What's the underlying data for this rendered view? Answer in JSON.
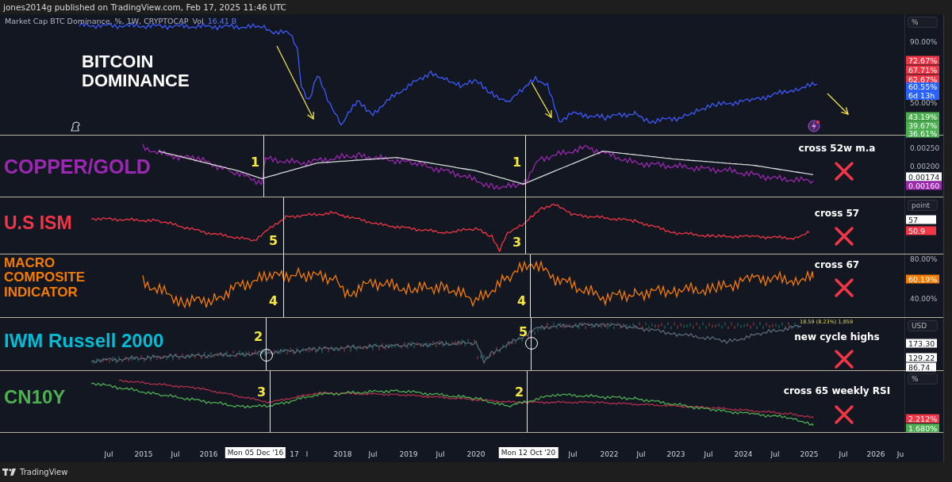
{
  "header": {
    "text": "jones2014g published on TradingView.com, Feb 17, 2025 11:46 UTC"
  },
  "panes": [
    {
      "kind": "dominance",
      "title": [
        "BITCOIN",
        "DOMINANCE"
      ],
      "color": "#ffffff",
      "legend": {
        "symbol": "Market Cap BTC Dominance, %, 1W, CRYPTOCAP",
        "volume_label": "Vol",
        "volume_value": "16.41 B"
      },
      "unit": "%",
      "ticks": [
        "90.00%",
        "50.00%"
      ],
      "tags": [
        {
          "text": "72.67%",
          "color": "#f23645"
        },
        {
          "text": "67.71%",
          "color": "#f23645"
        },
        {
          "text": "62.67%",
          "color": "#f23645"
        },
        {
          "text": "60.55%",
          "sub": "6d 13h",
          "color": "#2962ff"
        },
        {
          "text": "43.19%",
          "color": "#4caf50"
        },
        {
          "text": "39.67%",
          "color": "#4caf50"
        },
        {
          "text": "36.61%",
          "color": "#4caf50"
        }
      ]
    },
    {
      "kind": "copper",
      "title": [
        "COPPER/GOLD"
      ],
      "color": "#9c27b0",
      "note": "cross 52w m.a",
      "ticks": [
        "0.00250",
        "0.00200"
      ],
      "tags": [
        {
          "text": "0.00174",
          "color": "#ffffff"
        },
        {
          "text": "0.00160",
          "color": "#9c27b0"
        }
      ],
      "markers": [
        {
          "label": "1"
        },
        {
          "label": "1"
        }
      ]
    },
    {
      "kind": "ism",
      "title": [
        "U.S ISM"
      ],
      "color": "#f23645",
      "note": "cross 57",
      "unit": "point",
      "tags": [
        {
          "text": "57",
          "color": "#ffffff"
        },
        {
          "text": "50.9",
          "color": "#f23645"
        }
      ],
      "markers": [
        {
          "label": "5"
        },
        {
          "label": "3"
        }
      ]
    },
    {
      "kind": "macro",
      "title": [
        "MACRO",
        "COMPOSITE",
        "INDICATOR"
      ],
      "color": "#f57c00",
      "note": "cross 67",
      "ticks": [
        "80.00%",
        "40.00%"
      ],
      "tags": [
        {
          "text": "60.19%",
          "color": "#f57c00"
        }
      ],
      "markers": [
        {
          "label": "4"
        },
        {
          "label": "4"
        }
      ]
    },
    {
      "kind": "iwm",
      "title": [
        "IWM Russell 2000"
      ],
      "color": "#00bcd4",
      "note": "new cycle highs",
      "unit": "USD",
      "high_label": "18.59 (8.23%) 1,859",
      "tags": [
        {
          "text": "173.30",
          "color": "#ffffff"
        },
        {
          "text": "129.22",
          "color": "#ffffff"
        },
        {
          "text": "86.74",
          "color": "#ffffff"
        }
      ],
      "markers": [
        {
          "label": "2",
          "circled": true
        },
        {
          "label": "5",
          "circled": true
        }
      ]
    },
    {
      "kind": "cn10y",
      "title": [
        "CN10Y"
      ],
      "color": "#4caf50",
      "note": "cross 65 weekly RSI",
      "unit": "%",
      "tags": [
        {
          "text": "2.212%",
          "color": "#f23645"
        },
        {
          "text": "1.680%",
          "color": "#4caf50"
        }
      ],
      "markers": [
        {
          "label": "3"
        },
        {
          "label": "2"
        }
      ]
    }
  ],
  "time_axis": [
    {
      "label": "Jul",
      "kind": "tick"
    },
    {
      "label": "2015",
      "kind": "tick"
    },
    {
      "label": "Jul",
      "kind": "tick"
    },
    {
      "label": "2016",
      "kind": "tick"
    },
    {
      "label": "Mon 05 Dec '16",
      "kind": "cursor"
    },
    {
      "label": "17",
      "kind": "tick"
    },
    {
      "label": "l",
      "kind": "tick"
    },
    {
      "label": "2018",
      "kind": "tick"
    },
    {
      "label": "Jul",
      "kind": "tick"
    },
    {
      "label": "2019",
      "kind": "tick"
    },
    {
      "label": "Jul",
      "kind": "tick"
    },
    {
      "label": "2020",
      "kind": "tick"
    },
    {
      "label": "Mon 12 Oct '20",
      "kind": "cursor"
    },
    {
      "label": "Jul",
      "kind": "tick"
    },
    {
      "label": "2022",
      "kind": "tick"
    },
    {
      "label": "Jul",
      "kind": "tick"
    },
    {
      "label": "2023",
      "kind": "tick"
    },
    {
      "label": "Jul",
      "kind": "tick"
    },
    {
      "label": "2024",
      "kind": "tick"
    },
    {
      "label": "Jul",
      "kind": "tick"
    },
    {
      "label": "2025",
      "kind": "tick"
    },
    {
      "label": "Jul",
      "kind": "tick"
    },
    {
      "label": "2026",
      "kind": "tick"
    },
    {
      "label": "Ju",
      "kind": "tick"
    }
  ],
  "footer": {
    "brand": "TradingView"
  }
}
